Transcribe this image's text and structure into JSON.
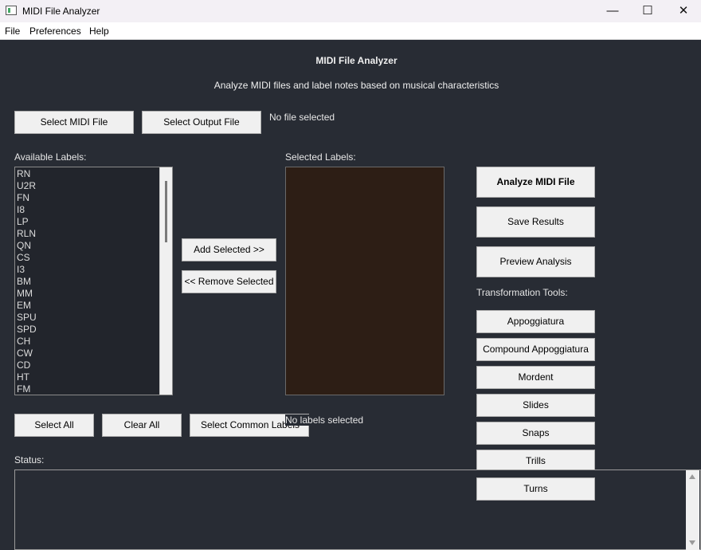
{
  "window": {
    "title": "MIDI File Analyzer",
    "minimize": "—",
    "maximize": "☐",
    "close": "✕"
  },
  "menu": [
    "File",
    "Preferences",
    "Help"
  ],
  "header": {
    "title": "MIDI File Analyzer",
    "subtitle": "Analyze MIDI files and label notes based on musical characteristics"
  },
  "file": {
    "select_midi": "Select MIDI File",
    "select_output": "Select Output File",
    "status": "No file selected"
  },
  "available": {
    "label": "Available Labels:",
    "items": [
      "RN",
      "U2R",
      "FN",
      "I8",
      "LP",
      "RLN",
      "QN",
      "CS",
      "I3",
      "BM",
      "MM",
      "EM",
      "SPU",
      "SPD",
      "CH",
      "CW",
      "CD",
      "HT",
      "FM"
    ]
  },
  "transfer": {
    "add": "Add Selected >>",
    "remove": "<< Remove Selected"
  },
  "selected": {
    "label": "Selected Labels:",
    "status": "No labels selected"
  },
  "bulk": {
    "select_all": "Select All",
    "clear_all": "Clear All",
    "select_common": "Select Common Labels"
  },
  "actions": {
    "analyze": "Analyze MIDI File",
    "save": "Save Results",
    "preview": "Preview Analysis"
  },
  "tools": {
    "label": "Transformation Tools:",
    "items": [
      "Appoggiatura",
      "Compound Appoggiatura",
      "Mordent",
      "Slides",
      "Snaps",
      "Trills",
      "Turns"
    ]
  },
  "status": {
    "label": "Status:"
  },
  "colors": {
    "background": "#282c34",
    "selected_list_bg": "#2d1e15"
  }
}
